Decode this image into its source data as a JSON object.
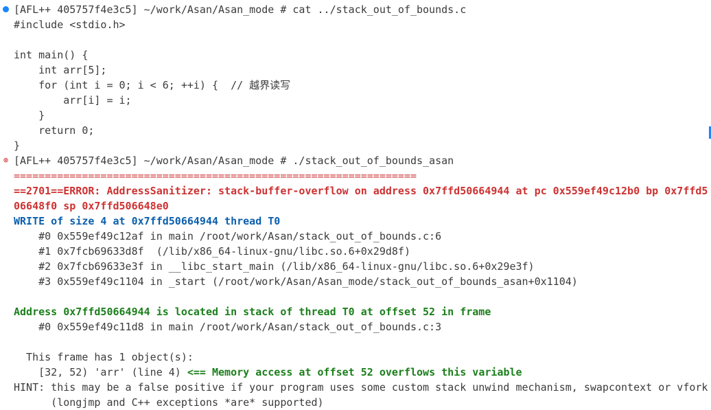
{
  "terminal": {
    "lines": [
      {
        "kind": "prompt-ok",
        "text": "[AFL++ 405757f4e3c5] ~/work/Asan/Asan_mode # cat ../stack_out_of_bounds.c"
      },
      {
        "kind": "code",
        "text": "#include <stdio.h>"
      },
      {
        "kind": "blank",
        "text": ""
      },
      {
        "kind": "code",
        "text": "int main() {"
      },
      {
        "kind": "code",
        "text": "    int arr[5];"
      },
      {
        "kind": "code",
        "text": "    for (int i = 0; i < 6; ++i) {  // 越界读写"
      },
      {
        "kind": "code",
        "text": "        arr[i] = i;"
      },
      {
        "kind": "code",
        "text": "    }"
      },
      {
        "kind": "code",
        "text": "    return 0;"
      },
      {
        "kind": "code",
        "text": "}"
      },
      {
        "kind": "prompt-err",
        "text": "[AFL++ 405757f4e3c5] ~/work/Asan/Asan_mode # ./stack_out_of_bounds_asan"
      },
      {
        "kind": "separator",
        "text": "================================================================="
      },
      {
        "kind": "error",
        "text": "==2701==ERROR: AddressSanitizer: stack-buffer-overflow on address 0x7ffd50664944 at pc 0x559ef49c12b0 bp 0x7ffd5"
      },
      {
        "kind": "error",
        "text": "06648f0 sp 0x7ffd506648e0"
      },
      {
        "kind": "write",
        "text": "WRITE of size 4 at 0x7ffd50664944 thread T0"
      },
      {
        "kind": "trace",
        "text": "    #0 0x559ef49c12af in main /root/work/Asan/stack_out_of_bounds.c:6"
      },
      {
        "kind": "trace",
        "text": "    #1 0x7fcb69633d8f  (/lib/x86_64-linux-gnu/libc.so.6+0x29d8f)"
      },
      {
        "kind": "trace",
        "text": "    #2 0x7fcb69633e3f in __libc_start_main (/lib/x86_64-linux-gnu/libc.so.6+0x29e3f)"
      },
      {
        "kind": "trace",
        "text": "    #3 0x559ef49c1104 in _start (/root/work/Asan/Asan_mode/stack_out_of_bounds_asan+0x1104)"
      },
      {
        "kind": "blank",
        "text": ""
      },
      {
        "kind": "location",
        "text": "Address 0x7ffd50664944 is located in stack of thread T0 at offset 52 in frame"
      },
      {
        "kind": "trace",
        "text": "    #0 0x559ef49c11d8 in main /root/work/Asan/stack_out_of_bounds.c:3"
      },
      {
        "kind": "blank",
        "text": ""
      },
      {
        "kind": "trace",
        "text": "  This frame has 1 object(s):"
      },
      {
        "kind": "object",
        "prefix": "    [32, 52) 'arr' (line 4) ",
        "highlight": "<== Memory access at offset 52 overflows this variable"
      },
      {
        "kind": "trace",
        "text": "HINT: this may be a false positive if your program uses some custom stack unwind mechanism, swapcontext or vfork"
      },
      {
        "kind": "trace",
        "text": "      (longjmp and C++ exceptions *are* supported)"
      }
    ]
  },
  "colors": {
    "error": "#cd3131",
    "write": "#0a5fae",
    "location": "#1b7f1b",
    "marker_ok": "#1a85ff",
    "marker_err": "#d13438"
  },
  "icons": {
    "ok_marker": "dot-icon",
    "err_marker": "error-circle-icon"
  }
}
